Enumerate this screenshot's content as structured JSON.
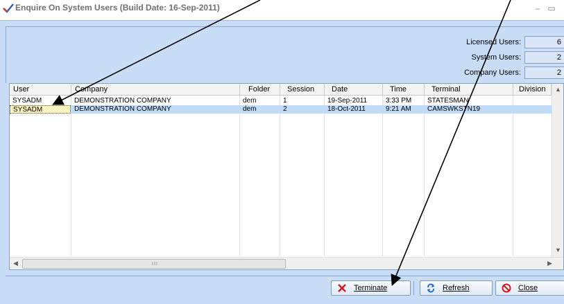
{
  "window": {
    "title": "Enquire On System Users (Build Date: 16-Sep-2011)",
    "minimize_glyph": "–",
    "maximize_glyph": "▭"
  },
  "summary": {
    "licensed_label": "Licensed Users:",
    "licensed_value": "6",
    "system_label": "System Users:",
    "system_value": "2",
    "company_label": "Company Users:",
    "company_value": "2"
  },
  "table": {
    "columns": [
      "User",
      "Company",
      "Folder",
      "Session",
      "Date",
      "Time",
      "Terminal",
      "Division"
    ],
    "rows": [
      {
        "user": "SYSADM",
        "company": "DEMONSTRATION COMPANY",
        "folder": "dem",
        "session": "1",
        "date": "19-Sep-2011",
        "time": "3:33 PM",
        "terminal": "STATESMAN",
        "division": ""
      },
      {
        "user": "SYSADM",
        "company": "DEMONSTRATION COMPANY",
        "folder": "dem",
        "session": "2",
        "date": "18-Oct-2011",
        "time": "9:21 AM",
        "terminal": "CAMSWKSTN19",
        "division": ""
      }
    ],
    "scroll_left": "◀",
    "scroll_right": "▶",
    "scroll_up": "▲",
    "scroll_down": "▼",
    "thumb_grip": "III"
  },
  "buttons": {
    "terminate": "Terminate",
    "refresh": "Refresh",
    "close": "Close"
  },
  "colors": {
    "window_bg": "#c9ddf6",
    "selected_row": "#c2dbf7",
    "terminate_icon": "#d21a1a",
    "refresh_icon": "#1f6fd1",
    "close_icon": "#d21a1a"
  }
}
